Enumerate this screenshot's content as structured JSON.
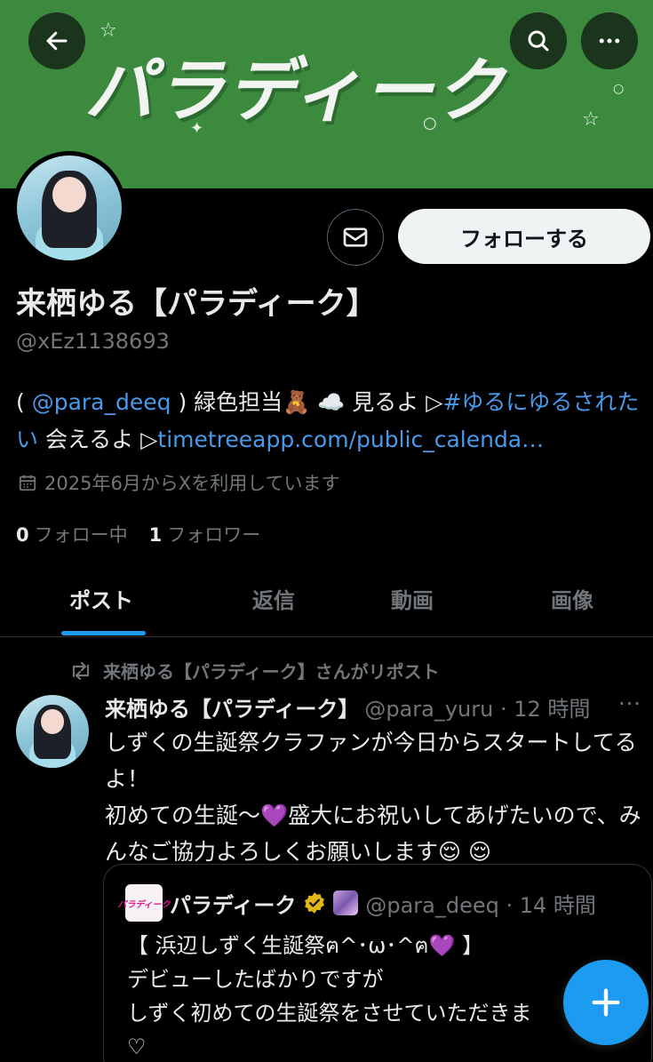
{
  "banner": {
    "title": "パラディーク"
  },
  "header": {
    "back_label": "←",
    "search_icon": "search-icon",
    "more_icon": "more-icon"
  },
  "profile": {
    "display_name": "来栖ゆる【パラディーク】",
    "handle": "@xEz1138693",
    "follow_label": "フォローする",
    "bio": {
      "part1": "( ",
      "mention": "@para_deeq",
      "part2": " ) 緑色担当🧸 ☁️ 見るよ ▷",
      "hashtag": "#ゆるにゆるされたい",
      "part3": " 会えるよ ▷",
      "url": "timetreeapp.com/public_calenda…"
    },
    "joined": "2025年6月からXを利用しています",
    "following_count": "0",
    "following_label": "フォロー中",
    "followers_count": "1",
    "followers_label": "フォロワー"
  },
  "tabs": [
    {
      "label": "ポスト",
      "active": true
    },
    {
      "label": "返信",
      "active": false
    },
    {
      "label": "動画",
      "active": false
    },
    {
      "label": "画像",
      "active": false
    }
  ],
  "post": {
    "repost_text": "来栖ゆる【パラディーク】さんがリポスト",
    "author": "来栖ゆる【パラディーク】",
    "handle_time": "@para_yuru · 12 時間",
    "more": "···",
    "text_line1": "しずくの生誕祭クラファンが今日からスタートしてるよ！",
    "text_line2": "初めての生誕〜💜盛大にお祝いしてあげたいので、みんなご協力よろしくお願いします😌 😌",
    "quote": {
      "logo_text": "パラディーク",
      "name": "パラディーク",
      "handle_time": "@para_deeq · 14 時間",
      "line1": "【 浜辺しずく生誕祭ฅ^･ω･^ฅ💜 】",
      "line2": "デビューしたばかりですが",
      "line3": "しずく初めての生誕祭をさせていただきま",
      "line4": "♡"
    }
  },
  "fab": {
    "label": "+"
  },
  "colors": {
    "accent": "#1d9bf0",
    "link": "#4a99e9",
    "banner": "#3b8a3e",
    "muted": "#71767b"
  }
}
